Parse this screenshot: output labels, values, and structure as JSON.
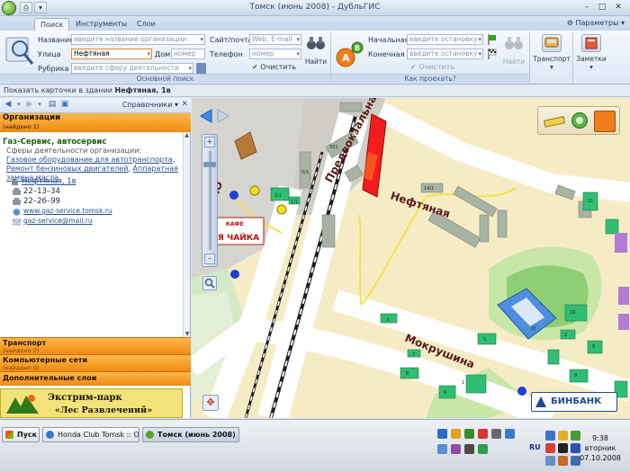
{
  "window": {
    "title": "Томск (июнь 2008) - ДубльГИС"
  },
  "ribbon": {
    "tabs": [
      "Поиск",
      "Инструменты",
      "Слои"
    ],
    "params_label": "Параметры",
    "search": {
      "name_label": "Название",
      "name_placeholder": "введите название организации",
      "street_label": "Улица",
      "street_value": "Нефтяная",
      "house_label": "Дом",
      "house_placeholder": "номер",
      "rubric_label": "Рубрика",
      "rubric_placeholder": "введите сферу деятельности",
      "site_label": "Сайт/почта",
      "site_placeholder": "Web, E-mail",
      "phone_label": "Телефон",
      "phone_placeholder": "номер",
      "clear_label": "Очистить",
      "find_label": "Найти",
      "group_title": "Основной поиск"
    },
    "route": {
      "start_label": "Начальная",
      "start_placeholder": "введите остановку",
      "end_label": "Конечная",
      "end_placeholder": "введите остановку",
      "clear_label": "Очистить",
      "find_label": "Найти",
      "group_title": "Как проехать?"
    },
    "transport_label": "Транспорт",
    "notes_label": "Заметки"
  },
  "infobar": {
    "prefix": "Показать карточки в здании",
    "address": "Нефтяная, 1в"
  },
  "panel": {
    "spravochniki": "Справочники",
    "orgs_title": "Организации",
    "orgs_found": "(найдено 1)",
    "org": {
      "name": "Газ-Сервис, автосервис",
      "spheres_title": "Сферы деятельности организации:",
      "spheres": [
        "Газовое оборудование для автотранспорта",
        "Ремонт бензиновых двигателей",
        "Аппаратная замена масла"
      ],
      "address": "Нефтяная, 1в",
      "phones": [
        "22–13–34",
        "22–26–99"
      ],
      "website": "www.gaz-service.tomsk.ru",
      "email": "gaz-service@mail.ru"
    },
    "sections": [
      "Транспорт",
      "Компьютерные сети",
      "Дополнительные слои"
    ],
    "section_subs": [
      "(найдено 0)",
      "(найдено 0)",
      ""
    ],
    "ad_line1": "Экстрим-парк",
    "ad_line2": "«Лес Развлечений»"
  },
  "map": {
    "street_predvokzalnaya": "Предвокзальна",
    "street_neftyanaya": "Нефтяная",
    "street_mokrushina": "Мокрушина",
    "street_pl": "пл. Ю",
    "kafe_sign": "КАФЕ",
    "chaika_sign": "ЯЯ ЧАЙКА",
    "binbank": "БИНБАНК",
    "building_labels": [
      "351",
      "2/1",
      "1/1",
      "3",
      "1",
      "7",
      "5",
      "6",
      "8",
      "10",
      "19",
      "14/1",
      "11",
      "2",
      "8",
      "9",
      "5/1"
    ]
  },
  "taskbar": {
    "start_label": "Пуск",
    "tasks": [
      "Honda Club Tomsk :: От...",
      "Томск (июнь 2008) - ..."
    ],
    "lang": "RU",
    "time": "9:38",
    "day": "вторник",
    "date": "07.10.2008"
  }
}
